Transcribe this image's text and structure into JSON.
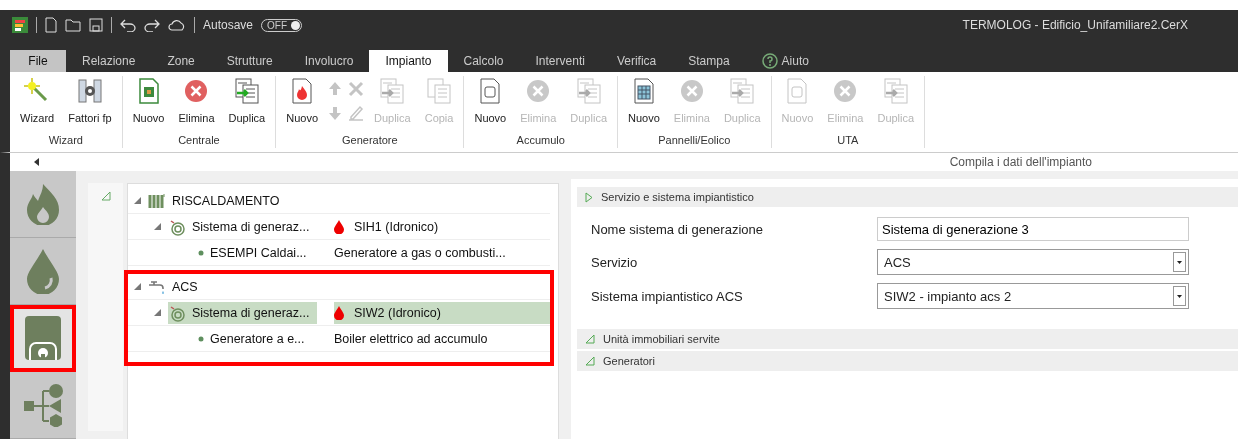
{
  "titlebar": {
    "autosave_label": "Autosave",
    "autosave": {
      "label": "OFF",
      "on": false
    },
    "title": "TERMOLOG - Edificio_Unifamiliare2.CerX"
  },
  "tabs": [
    {
      "label": "File",
      "kind": "file",
      "selected": false
    },
    {
      "label": "Relazione",
      "kind": "tab",
      "selected": false
    },
    {
      "label": "Zone",
      "kind": "tab",
      "selected": false
    },
    {
      "label": "Strutture",
      "kind": "tab",
      "selected": false
    },
    {
      "label": "Involucro",
      "kind": "tab",
      "selected": false
    },
    {
      "label": "Impianto",
      "kind": "tab",
      "selected": true
    },
    {
      "label": "Calcolo",
      "kind": "tab",
      "selected": false
    },
    {
      "label": "Interventi",
      "kind": "tab",
      "selected": false
    },
    {
      "label": "Verifica",
      "kind": "tab",
      "selected": false
    },
    {
      "label": "Stampa",
      "kind": "tab",
      "selected": false
    },
    {
      "label": "Aiuto",
      "kind": "help",
      "selected": false
    }
  ],
  "ribbon": [
    {
      "label": "Wizard",
      "buttons": [
        {
          "kind": "wizard",
          "label": "Wizard",
          "disabled": false
        },
        {
          "kind": "factors",
          "label": "Fattori fp",
          "disabled": false
        }
      ]
    },
    {
      "label": "Centrale",
      "buttons": [
        {
          "kind": "new-plant",
          "label": "Nuovo",
          "disabled": false
        },
        {
          "kind": "delete",
          "label": "Elimina",
          "disabled": false
        },
        {
          "kind": "duplicate",
          "label": "Duplica",
          "disabled": false
        }
      ]
    },
    {
      "label": "Generatore",
      "buttons": [
        {
          "kind": "new-flame",
          "label": "Nuovo",
          "disabled": false
        },
        {
          "kind": "move-pair",
          "disabled": true
        },
        {
          "kind": "edit-pair",
          "disabled": true
        },
        {
          "kind": "duplicate",
          "label": "Duplica",
          "disabled": true
        },
        {
          "kind": "copy",
          "label": "Copia",
          "disabled": true
        }
      ]
    },
    {
      "label": "Accumulo",
      "buttons": [
        {
          "kind": "new-tank",
          "label": "Nuovo",
          "disabled": false
        },
        {
          "kind": "delete",
          "label": "Elimina",
          "disabled": true
        },
        {
          "kind": "duplicate",
          "label": "Duplica",
          "disabled": true
        }
      ]
    },
    {
      "label": "Pannelli/Eolico",
      "buttons": [
        {
          "kind": "new-panel",
          "label": "Nuovo",
          "disabled": false
        },
        {
          "kind": "delete",
          "label": "Elimina",
          "disabled": true
        },
        {
          "kind": "duplicate",
          "label": "Duplica",
          "disabled": true
        }
      ]
    },
    {
      "label": "UTA",
      "buttons": [
        {
          "kind": "new-tank",
          "label": "Nuovo",
          "disabled": true
        },
        {
          "kind": "delete",
          "label": "Elimina",
          "disabled": true
        },
        {
          "kind": "duplicate",
          "label": "Duplica",
          "disabled": true
        }
      ]
    }
  ],
  "hint": "Compila i dati dell'impianto",
  "sidebar": [
    {
      "kind": "flame",
      "selected": false,
      "highlighted": false
    },
    {
      "kind": "drop",
      "selected": false,
      "highlighted": false
    },
    {
      "kind": "boiler",
      "selected": true,
      "highlighted": true
    },
    {
      "kind": "diagram",
      "selected": false,
      "highlighted": false
    }
  ],
  "tree": [
    {
      "kind": "heating-group",
      "name": "RISCALDAMENTO",
      "expanded": true,
      "highlighted": false,
      "children": [
        {
          "kind": "system",
          "name": "Sistema di generaz...",
          "value": "SIH1 (Idronico)",
          "expanded": true,
          "selected": false,
          "children": [
            {
              "kind": "generator",
              "name": "ESEMPI Caldai...",
              "value": "Generatore a gas o combusti...",
              "selected": false
            }
          ]
        }
      ]
    },
    {
      "kind": "dhw-group",
      "name": "ACS",
      "expanded": true,
      "highlighted": true,
      "children": [
        {
          "kind": "system",
          "name": "Sistema di generaz...",
          "value": "SIW2 (Idronico)",
          "expanded": true,
          "selected": true,
          "children": [
            {
              "kind": "generator",
              "name": "Generatore a e...",
              "value": "Boiler elettrico ad accumulo",
              "selected": false
            }
          ]
        }
      ]
    }
  ],
  "form": [
    {
      "title": "Servizio e sistema impiantistico",
      "expanded": true,
      "fields": [
        {
          "kind": "text",
          "label": "Nome sistema di generazione",
          "value": "Sistema di generazione 3"
        },
        {
          "kind": "select",
          "label": "Servizio",
          "value": "ACS"
        },
        {
          "kind": "select",
          "label": "Sistema impiantistico ACS",
          "value": "SIW2 - impianto acs 2"
        }
      ]
    },
    {
      "title": "Unità immobiliari servite",
      "expanded": false
    },
    {
      "title": "Generatori",
      "expanded": false
    }
  ]
}
